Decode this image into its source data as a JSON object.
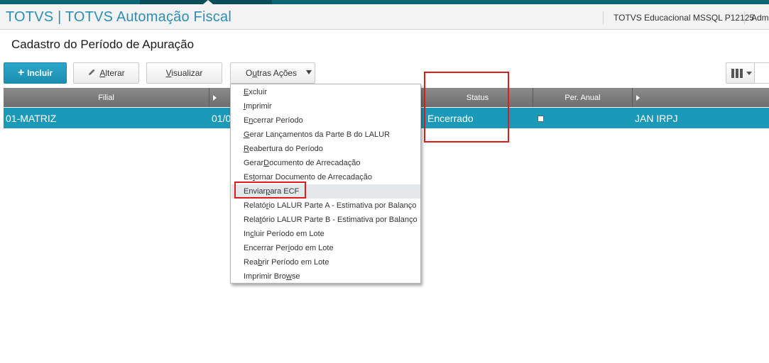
{
  "titlebar": {
    "app_title": "TOTVS | TOTVS Automação Fiscal",
    "environment": "TOTVS Educacional MSSQL P12125",
    "user": "Admi"
  },
  "page_title": "Cadastro do Período de Apuração",
  "toolbar": {
    "incluir": {
      "icon": "+",
      "label": "Incluir"
    },
    "alterar": {
      "icon": "pencil-icon",
      "label_u": "A",
      "label_rest": "lterar"
    },
    "visualizar": {
      "label_u": "V",
      "label_rest": "isualizar"
    },
    "outras": {
      "label_pre": "O",
      "label_u": "u",
      "label_rest": "tras Ações"
    }
  },
  "grid": {
    "columns": [
      "Filial",
      "",
      "",
      "Status",
      "Per. Anual",
      ""
    ],
    "row": {
      "filial": "01-MATRIZ",
      "date": "01/0",
      "status": "Encerrado",
      "per_anual": false,
      "last": "JAN IRPJ"
    },
    "colors": {
      "header": "#7a7a7a",
      "selected_row": "#1a9ab8"
    }
  },
  "menu": {
    "items": [
      {
        "pre": "",
        "u": "E",
        "rest": "xcluir"
      },
      {
        "pre": "",
        "u": "I",
        "rest": "mprimir"
      },
      {
        "pre": "E",
        "u": "n",
        "rest": "cerrar Período"
      },
      {
        "pre": "",
        "u": "G",
        "rest": "erar Lançamentos da Parte B do LALUR"
      },
      {
        "pre": "",
        "u": "R",
        "rest": "eabertura do Período"
      },
      {
        "pre": "Gerar ",
        "u": "D",
        "rest": "ocumento de Arrecadação"
      },
      {
        "pre": "Es",
        "u": "t",
        "rest": "ornar Documento de Arrecadação"
      },
      {
        "pre": "Enviar ",
        "u": "p",
        "rest": "ara ECF"
      },
      {
        "pre": "Relató",
        "u": "r",
        "rest": "io LALUR Parte A - Estimativa por Balanço"
      },
      {
        "pre": "Rela",
        "u": "t",
        "rest": "ório LALUR Parte B - Estimativa por Balanço"
      },
      {
        "pre": "In",
        "u": "c",
        "rest": "luir Período em Lote"
      },
      {
        "pre": "Encerrar Per",
        "u": "í",
        "rest": "odo em Lote"
      },
      {
        "pre": "Rea",
        "u": "b",
        "rest": "rir Período em Lote"
      },
      {
        "pre": "Imprimir Bro",
        "u": "w",
        "rest": "se"
      }
    ],
    "highlighted_index": 7
  },
  "annotations": {
    "color": "#e01b1b"
  }
}
